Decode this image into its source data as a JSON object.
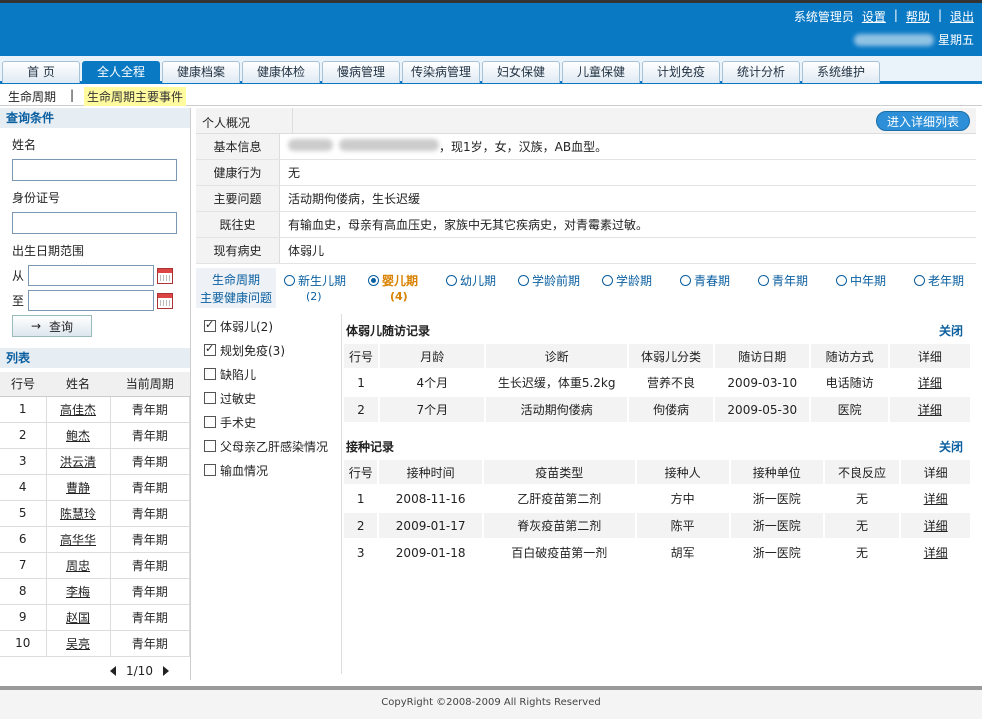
{
  "header": {
    "user": "系统管理员",
    "settings": "设置",
    "help": "帮助",
    "logout": "退出",
    "weekday": "星期五"
  },
  "tabs": [
    {
      "label": "首 页"
    },
    {
      "label": "全人全程"
    },
    {
      "label": "健康档案"
    },
    {
      "label": "健康体检"
    },
    {
      "label": "慢病管理"
    },
    {
      "label": "传染病管理"
    },
    {
      "label": "妇女保健"
    },
    {
      "label": "儿童保健"
    },
    {
      "label": "计划免疫"
    },
    {
      "label": "统计分析"
    },
    {
      "label": "系统维护"
    }
  ],
  "subnav": {
    "item1": "生命周期",
    "sep": "|",
    "item2": "生命周期主要事件"
  },
  "query": {
    "title": "查询条件",
    "name_label": "姓名",
    "id_label": "身份证号",
    "birth_label": "出生日期范围",
    "from_label": "从",
    "to_label": "至",
    "button": "查询"
  },
  "list": {
    "title": "列表",
    "headers": [
      "行号",
      "姓名",
      "当前周期"
    ],
    "rows": [
      {
        "no": "1",
        "name": "高佳杰",
        "period": "青年期"
      },
      {
        "no": "2",
        "name": "鲍杰",
        "period": "青年期"
      },
      {
        "no": "3",
        "name": "洪云清",
        "period": "青年期"
      },
      {
        "no": "4",
        "name": "曹静",
        "period": "青年期"
      },
      {
        "no": "5",
        "name": "陈慧玲",
        "period": "青年期"
      },
      {
        "no": "6",
        "name": "高华华",
        "period": "青年期"
      },
      {
        "no": "7",
        "name": "周忠",
        "period": "青年期"
      },
      {
        "no": "8",
        "name": "李梅",
        "period": "青年期"
      },
      {
        "no": "9",
        "name": "赵国",
        "period": "青年期"
      },
      {
        "no": "10",
        "name": "吴亮",
        "period": "青年期"
      }
    ],
    "pager": "1/10"
  },
  "profile": {
    "title": "个人概况",
    "detail_button": "进入详细列表",
    "rows": [
      {
        "k": "基本信息",
        "v": "，现1岁，女，汉族，AB血型。"
      },
      {
        "k": "健康行为",
        "v": "无"
      },
      {
        "k": "主要问题",
        "v": "活动期佝偻病，生长迟缓"
      },
      {
        "k": "既往史",
        "v": "有输血史，母亲有高血压史，家族中无其它疾病史，对青霉素过敏。"
      },
      {
        "k": "现有病史",
        "v": "体弱儿"
      }
    ]
  },
  "periods": {
    "label1": "生命周期",
    "label2": "主要健康问题",
    "items": [
      {
        "name": "新生儿期",
        "count": "(2)"
      },
      {
        "name": "婴儿期",
        "count": "(4)"
      },
      {
        "name": "幼儿期",
        "count": ""
      },
      {
        "name": "学龄前期",
        "count": ""
      },
      {
        "name": "学龄期",
        "count": ""
      },
      {
        "name": "青春期",
        "count": ""
      },
      {
        "name": "青年期",
        "count": ""
      },
      {
        "name": "中年期",
        "count": ""
      },
      {
        "name": "老年期",
        "count": ""
      }
    ]
  },
  "events": [
    {
      "label": "体弱儿(2)"
    },
    {
      "label": "规划免疫(3)"
    },
    {
      "label": "缺陷儿"
    },
    {
      "label": "过敏史"
    },
    {
      "label": "手术史"
    },
    {
      "label": "父母亲乙肝感染情况"
    },
    {
      "label": "输血情况"
    }
  ],
  "weak": {
    "title": "体弱儿随访记录",
    "close": "关闭",
    "headers": [
      "行号",
      "月龄",
      "诊断",
      "体弱儿分类",
      "随访日期",
      "随访方式",
      "详细"
    ],
    "rows": [
      {
        "no": "1",
        "age": "4个月",
        "diag": "生长迟缓，体重5.2kg",
        "cls": "营养不良",
        "date": "2009-03-10",
        "way": "电话随访",
        "detail": "详细"
      },
      {
        "no": "2",
        "age": "7个月",
        "diag": "活动期佝偻病",
        "cls": "佝偻病",
        "date": "2009-05-30",
        "way": "医院",
        "detail": "详细"
      }
    ]
  },
  "vacc": {
    "title": "接种记录",
    "close": "关闭",
    "headers": [
      "行号",
      "接种时间",
      "疫苗类型",
      "接种人",
      "接种单位",
      "不良反应",
      "详细"
    ],
    "rows": [
      {
        "no": "1",
        "time": "2008-11-16",
        "type": "乙肝疫苗第二剂",
        "person": "方中",
        "unit": "浙一医院",
        "reaction": "无",
        "detail": "详细"
      },
      {
        "no": "2",
        "time": "2009-01-17",
        "type": "脊灰疫苗第二剂",
        "person": "陈平",
        "unit": "浙一医院",
        "reaction": "无",
        "detail": "详细"
      },
      {
        "no": "3",
        "time": "2009-01-18",
        "type": "百白破疫苗第一剂",
        "person": "胡军",
        "unit": "浙一医院",
        "reaction": "无",
        "detail": "详细"
      }
    ]
  },
  "footer": "CopyRight ©2008-2009 All Rights Reserved",
  "colors": {
    "brand": "#0a79c4",
    "accent": "#d98200"
  }
}
